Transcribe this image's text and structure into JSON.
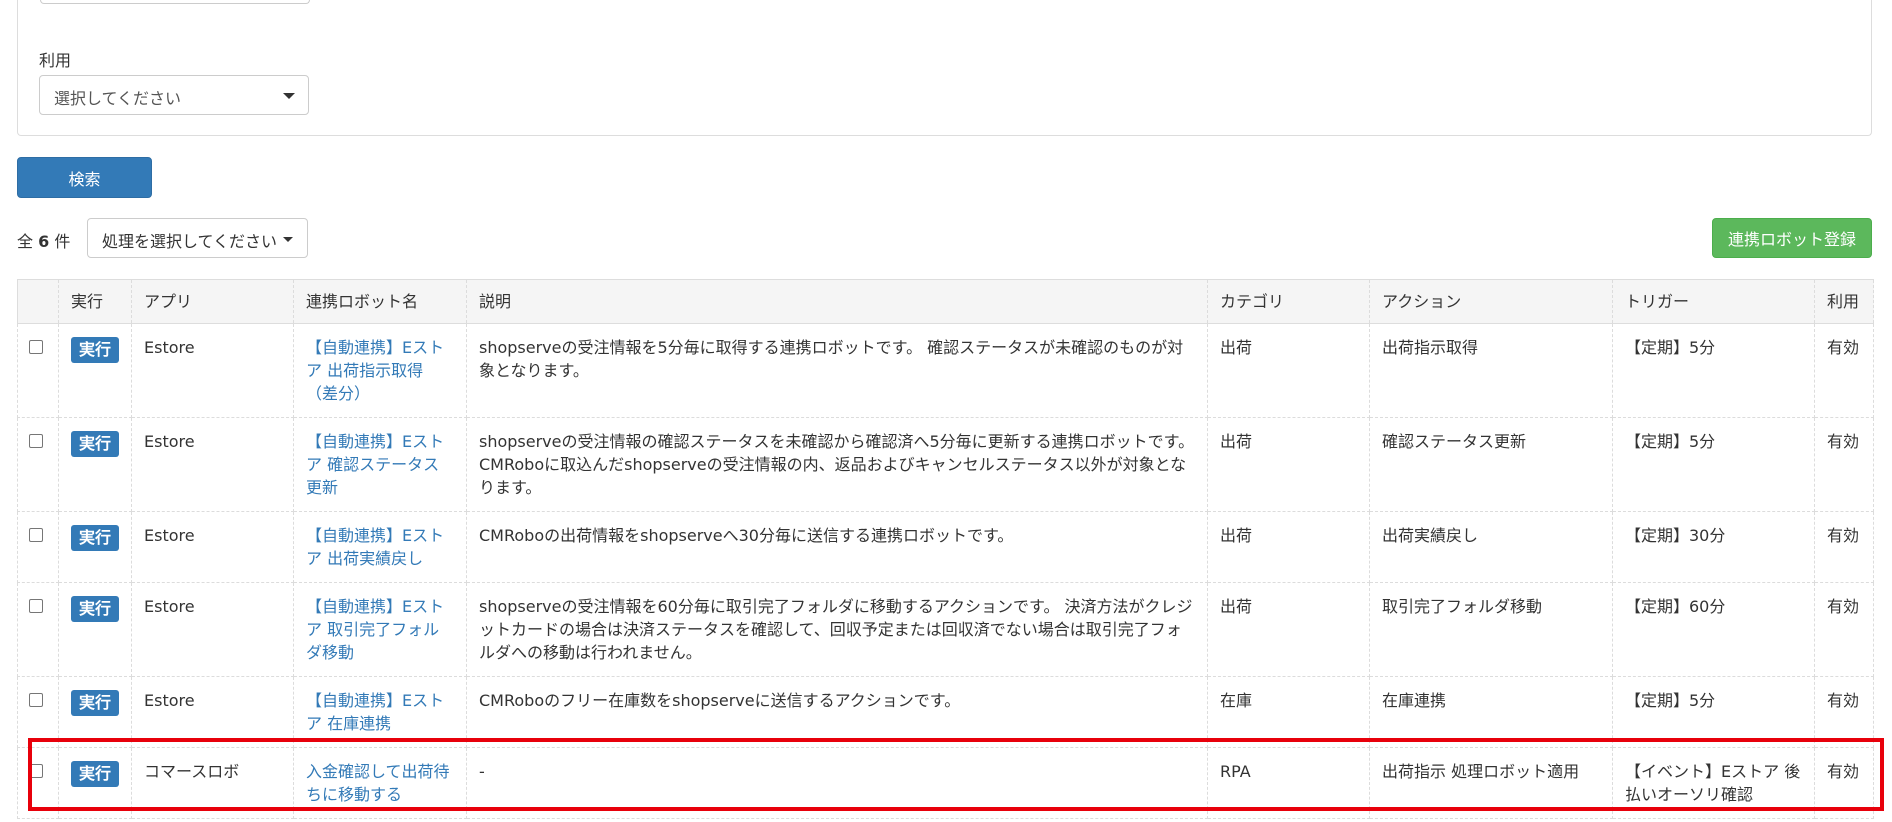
{
  "filter": {
    "label": "利用",
    "select_value": "選択してください"
  },
  "search_button": "検索",
  "summary": {
    "prefix": "全",
    "count": "6",
    "suffix": "件"
  },
  "bulk_action": "処理を選択してください",
  "register_button": "連携ロボット登録",
  "table": {
    "headers": [
      "実行",
      "アプリ",
      "連携ロボット名",
      "説明",
      "カテゴリ",
      "アクション",
      "トリガー",
      "利用"
    ],
    "rows": [
      {
        "run": "実行",
        "app": "Estore",
        "name": "【自動連携】Eストア 出荷指示取得（差分）",
        "description": "shopserveの受注情報を5分毎に取得する連携ロボットです。 確認ステータスが未確認のものが対象となります。",
        "category": "出荷",
        "action": "出荷指示取得",
        "trigger": "【定期】5分",
        "status": "有効"
      },
      {
        "run": "実行",
        "app": "Estore",
        "name": "【自動連携】Eストア 確認ステータス更新",
        "description": "shopserveの受注情報の確認ステータスを未確認から確認済へ5分毎に更新する連携ロボットです。 CMRoboに取込んだshopserveの受注情報の内、返品およびキャンセルステータス以外が対象となります。",
        "category": "出荷",
        "action": "確認ステータス更新",
        "trigger": "【定期】5分",
        "status": "有効"
      },
      {
        "run": "実行",
        "app": "Estore",
        "name": "【自動連携】Eストア 出荷実績戻し",
        "description": "CMRoboの出荷情報をshopserveへ30分毎に送信する連携ロボットです。",
        "category": "出荷",
        "action": "出荷実績戻し",
        "trigger": "【定期】30分",
        "status": "有効"
      },
      {
        "run": "実行",
        "app": "Estore",
        "name": "【自動連携】Eストア 取引完了フォルダ移動",
        "description": "shopserveの受注情報を60分毎に取引完了フォルダに移動するアクションです。 決済方法がクレジットカードの場合は決済ステータスを確認して、回収予定または回収済でない場合は取引完了フォルダへの移動は行われません。",
        "category": "出荷",
        "action": "取引完了フォルダ移動",
        "trigger": "【定期】60分",
        "status": "有効"
      },
      {
        "run": "実行",
        "app": "Estore",
        "name": "【自動連携】Eストア 在庫連携",
        "description": "CMRoboのフリー在庫数をshopserveに送信するアクションです。",
        "category": "在庫",
        "action": "在庫連携",
        "trigger": "【定期】5分",
        "status": "有効"
      },
      {
        "run": "実行",
        "app": "コマースロボ",
        "name": "入金確認して出荷待ちに移動する",
        "description": "-",
        "category": "RPA",
        "action": "出荷指示 処理ロボット適用",
        "trigger": "【イベント】Eストア 後払いオーソリ確認",
        "status": "有効"
      }
    ]
  }
}
